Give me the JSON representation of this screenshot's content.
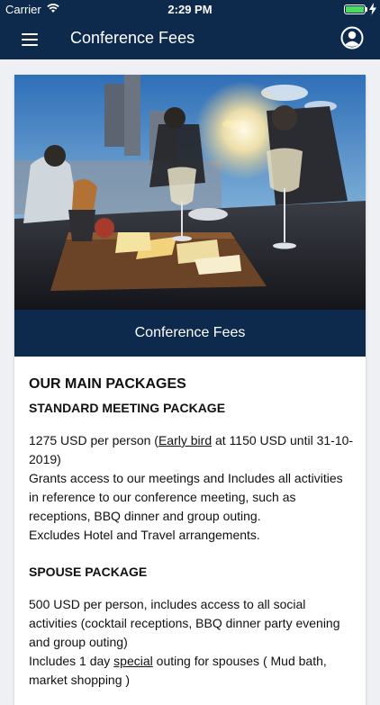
{
  "status_bar": {
    "carrier": "Carrier",
    "time": "2:29 PM",
    "battery_level": 1.0,
    "battery_color": "#4cd964"
  },
  "nav": {
    "title": "Conference Fees",
    "menu_icon": "hamburger-icon",
    "profile_icon": "user-profile-icon",
    "background": "#0d2a4d"
  },
  "banner": {
    "title": "Conference Fees"
  },
  "content": {
    "heading": "OUR MAIN PACKAGES",
    "standard": {
      "title": "STANDARD MEETING PACKAGE",
      "price_prefix": "1275 USD per person (",
      "early_bird_link": "Early bird",
      "price_suffix": " at 1150 USD until 31-10-2019)",
      "desc_1": "Grants access to our meetings and Includes all activities in reference to our conference meeting, such as receptions, BBQ dinner and group outing.",
      "desc_2": "Excludes Hotel and Travel arrangements."
    },
    "spouse": {
      "title": "SPOUSE PACKAGE",
      "desc_1": "500 USD per person, includes access to all social activities (cocktail receptions, BBQ dinner party evening and group outing)",
      "desc_2_prefix": "Includes 1 day ",
      "desc_2_link": "special",
      "desc_2_suffix": " outing for spouses ( Mud bath, market shopping )"
    }
  }
}
